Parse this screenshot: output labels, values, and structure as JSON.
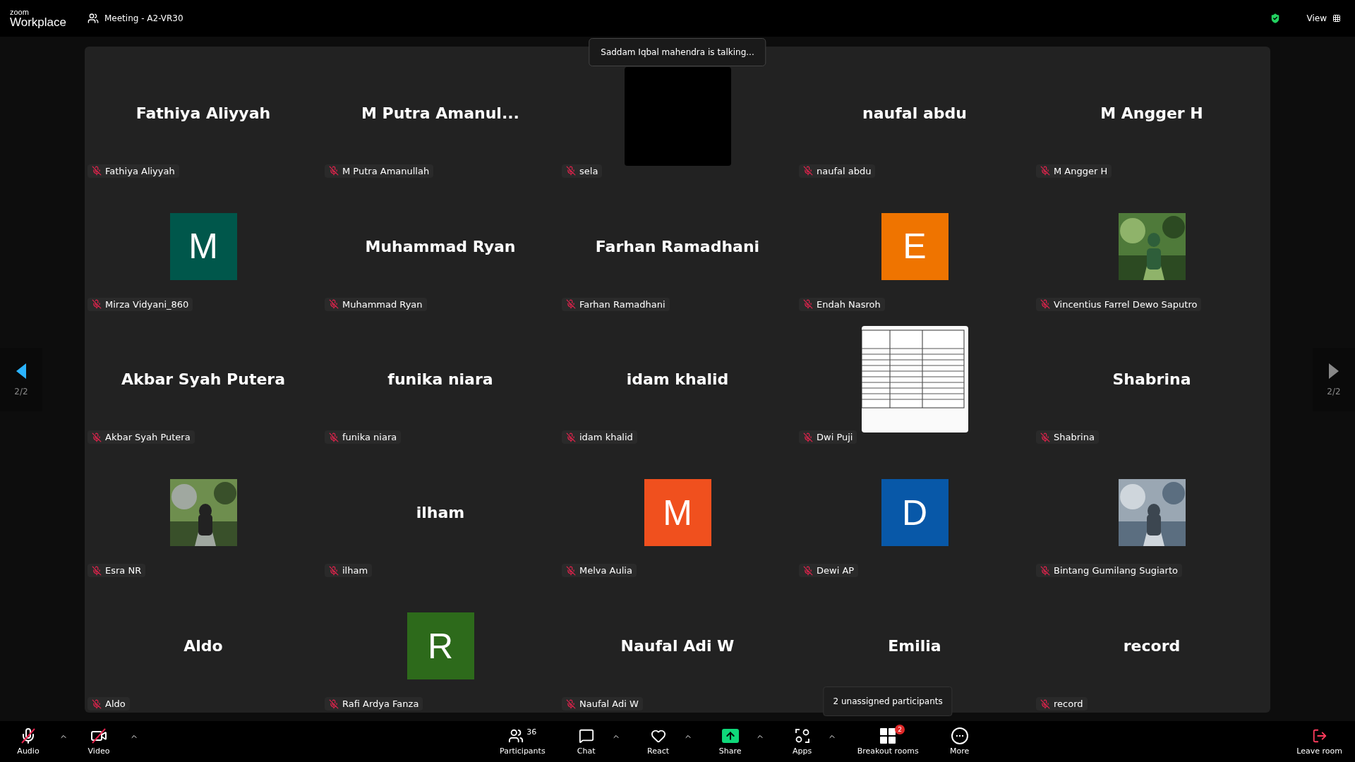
{
  "app": {
    "logo_top": "zoom",
    "logo_bottom": "Workplace"
  },
  "meeting": {
    "title": "Meeting - A2-VR30"
  },
  "view_button": {
    "label": "View"
  },
  "talking_toast": "Saddam Iqbal mahendra is talking...",
  "pager": {
    "prev": {
      "label": "2/2",
      "enabled": true
    },
    "next": {
      "label": "2/2",
      "enabled": false
    }
  },
  "participants": [
    {
      "kind": "name",
      "display": "Fathiya Aliyyah",
      "name": "Fathiya Aliyyah",
      "muted": true
    },
    {
      "kind": "name",
      "display": "M Putra Amanul...",
      "name": "M Putra Amanullah",
      "muted": true
    },
    {
      "kind": "video",
      "name": "sela",
      "muted": true
    },
    {
      "kind": "name",
      "display": "naufal abdu",
      "name": "naufal abdu",
      "muted": true
    },
    {
      "kind": "name",
      "display": "M Angger H",
      "name": "M Angger H",
      "muted": true
    },
    {
      "kind": "avatar",
      "initial": "M",
      "color": "#00574b",
      "name": "Mirza Vidyani_860",
      "muted": true
    },
    {
      "kind": "name",
      "display": "Muhammad Ryan",
      "name": "Muhammad Ryan",
      "muted": true
    },
    {
      "kind": "name",
      "display": "Farhan Ramadhani",
      "name": "Farhan Ramadhani",
      "muted": true
    },
    {
      "kind": "avatar",
      "initial": "E",
      "color": "#ef7400",
      "name": "Endah Nasroh",
      "muted": true
    },
    {
      "kind": "picture",
      "name": "Vincentius Farrel Dewo Saputro",
      "muted": true
    },
    {
      "kind": "name",
      "display": "Akbar Syah Putera",
      "name": "Akbar Syah Putera",
      "muted": true
    },
    {
      "kind": "name",
      "display": "funika niara",
      "name": "funika niara",
      "muted": true
    },
    {
      "kind": "name",
      "display": "idam khalid",
      "name": "idam khalid",
      "muted": true
    },
    {
      "kind": "picture",
      "name": "Dwi Puji",
      "muted": true
    },
    {
      "kind": "name",
      "display": "Shabrina",
      "name": "Shabrina",
      "muted": true
    },
    {
      "kind": "picture",
      "name": "Esra NR",
      "muted": true
    },
    {
      "kind": "name",
      "display": "ilham",
      "name": "ilham",
      "muted": true
    },
    {
      "kind": "avatar",
      "initial": "M",
      "color": "#f0501e",
      "name": "Melva Aulia",
      "muted": true
    },
    {
      "kind": "avatar",
      "initial": "D",
      "color": "#0858a8",
      "name": "Dewi AP",
      "muted": true
    },
    {
      "kind": "picture",
      "name": "Bintang Gumilang Sugiarto",
      "muted": true
    },
    {
      "kind": "name",
      "display": "Aldo",
      "name": "Aldo",
      "muted": true
    },
    {
      "kind": "avatar",
      "initial": "R",
      "color": "#2d6a1b",
      "name": "Rafi Ardya Fanza",
      "muted": true
    },
    {
      "kind": "name",
      "display": "Naufal Adi W",
      "name": "Naufal Adi W",
      "muted": true
    },
    {
      "kind": "name",
      "display": "Emilia"
    },
    {
      "kind": "name",
      "display": "record",
      "name": "record",
      "muted": true
    }
  ],
  "toolbar": {
    "left": [
      {
        "kind": "audio",
        "label": "Audio",
        "off": true,
        "menu": true
      },
      {
        "kind": "video",
        "label": "Video",
        "off": true,
        "menu": true
      }
    ],
    "center": [
      {
        "kind": "participants",
        "label": "Participants",
        "count": "36",
        "menu": false
      },
      {
        "kind": "chat",
        "label": "Chat",
        "menu": true
      },
      {
        "kind": "react",
        "label": "React",
        "menu": true
      },
      {
        "kind": "share",
        "label": "Share",
        "menu": true
      },
      {
        "kind": "apps",
        "label": "Apps",
        "menu": true
      },
      {
        "kind": "breakout",
        "label": "Breakout rooms",
        "badge": "2",
        "tooltip": "2 unassigned participants",
        "menu": false
      },
      {
        "kind": "more",
        "label": "More",
        "menu": false
      }
    ],
    "leave": {
      "label": "Leave room"
    }
  }
}
